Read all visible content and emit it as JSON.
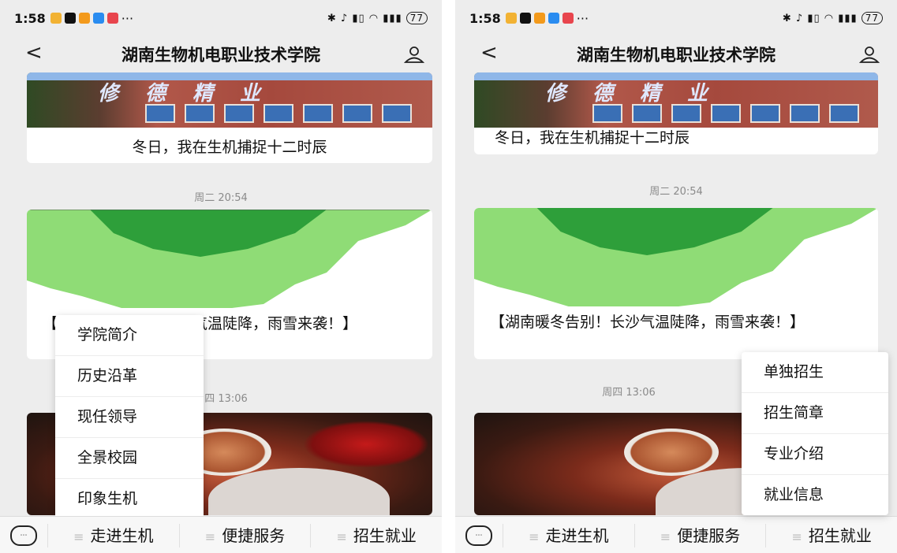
{
  "status": {
    "time": "1:58",
    "dots": "···",
    "battery": "77"
  },
  "title": "湖南生物机电职业技术学院",
  "icons": {
    "back": "chevron-left-icon",
    "user": "user-icon",
    "keyboard": "keyboard-icon"
  },
  "card_top": {
    "caption": "冬日，我在生机捕捉十二时辰",
    "banner_text": "修德精业"
  },
  "timestamps": {
    "tue": "周二 20:54",
    "thu": "周四 13:06"
  },
  "map_card": {
    "caption": "【湖南暖冬告别！长沙气温陡降，雨雪来袭！】"
  },
  "tabs": [
    "走进生机",
    "便捷服务",
    "招生就业"
  ],
  "menu_left": [
    "学院简介",
    "历史沿革",
    "现任领导",
    "全景校园",
    "印象生机"
  ],
  "menu_right": [
    "单独招生",
    "招生简章",
    "专业介绍",
    "就业信息"
  ],
  "colors": {
    "map_dark_green": "#2e9f3a",
    "map_light_green": "#8fdc76",
    "background": "#ededed"
  }
}
